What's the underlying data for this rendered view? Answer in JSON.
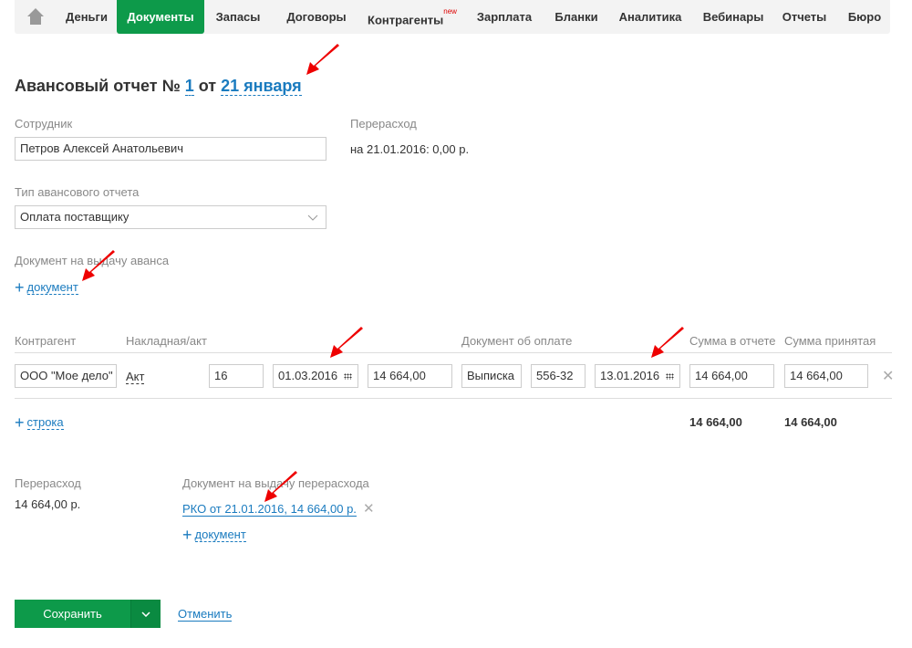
{
  "nav": {
    "home_icon": "home-icon",
    "items": [
      {
        "label": "Деньги",
        "active": false
      },
      {
        "label": "Документы",
        "active": true
      },
      {
        "label": "Запасы"
      },
      {
        "label": "Договоры"
      },
      {
        "label": "Контрагенты",
        "badge": "new"
      },
      {
        "label": "Зарплата"
      },
      {
        "label": "Бланки"
      },
      {
        "label": "Аналитика"
      },
      {
        "label": "Вебинары"
      },
      {
        "label": "Отчеты"
      },
      {
        "label": "Бюро"
      }
    ],
    "accent": "#0d9a4a"
  },
  "title": {
    "prefix": "Авансовый отчет №",
    "number": "1",
    "of": "от",
    "date": "21 января"
  },
  "employee": {
    "label": "Сотрудник",
    "value": "Петров Алексей Анатольевич"
  },
  "overspend_top": {
    "label": "Перерасход",
    "value": "на 21.01.2016: 0,00 р."
  },
  "report_type": {
    "label": "Тип авансового отчета",
    "value": "Оплата поставщику"
  },
  "advance_doc": {
    "label": "Документ на выдачу аванса",
    "add_label": "документ"
  },
  "table": {
    "headers": {
      "counterparty": "Контрагент",
      "invoice": "Накладная/акт",
      "payment_doc": "Документ об оплате",
      "sum_report": "Сумма в отчете",
      "sum_accepted": "Сумма принятая"
    },
    "row": {
      "counterparty": "ООО \"Мое дело\"",
      "invoice_type": "Акт",
      "invoice_number": "16",
      "invoice_date": "01.03.2016",
      "invoice_sum": "14 664,00",
      "payment_type": "Выписка",
      "payment_number": "556-32",
      "payment_date": "13.01.2016",
      "sum_report": "14 664,00",
      "sum_accepted": "14 664,00"
    },
    "add_row_label": "строка",
    "total_report": "14 664,00",
    "total_accepted": "14 664,00"
  },
  "overspend": {
    "label": "Перерасход",
    "value": "14 664,00 р.",
    "doc_label": "Документ на выдачу перерасхода",
    "doc_link": "РКО от 21.01.2016, 14 664,00 р.",
    "add_label": "документ"
  },
  "actions": {
    "save": "Сохранить",
    "cancel": "Отменить"
  }
}
